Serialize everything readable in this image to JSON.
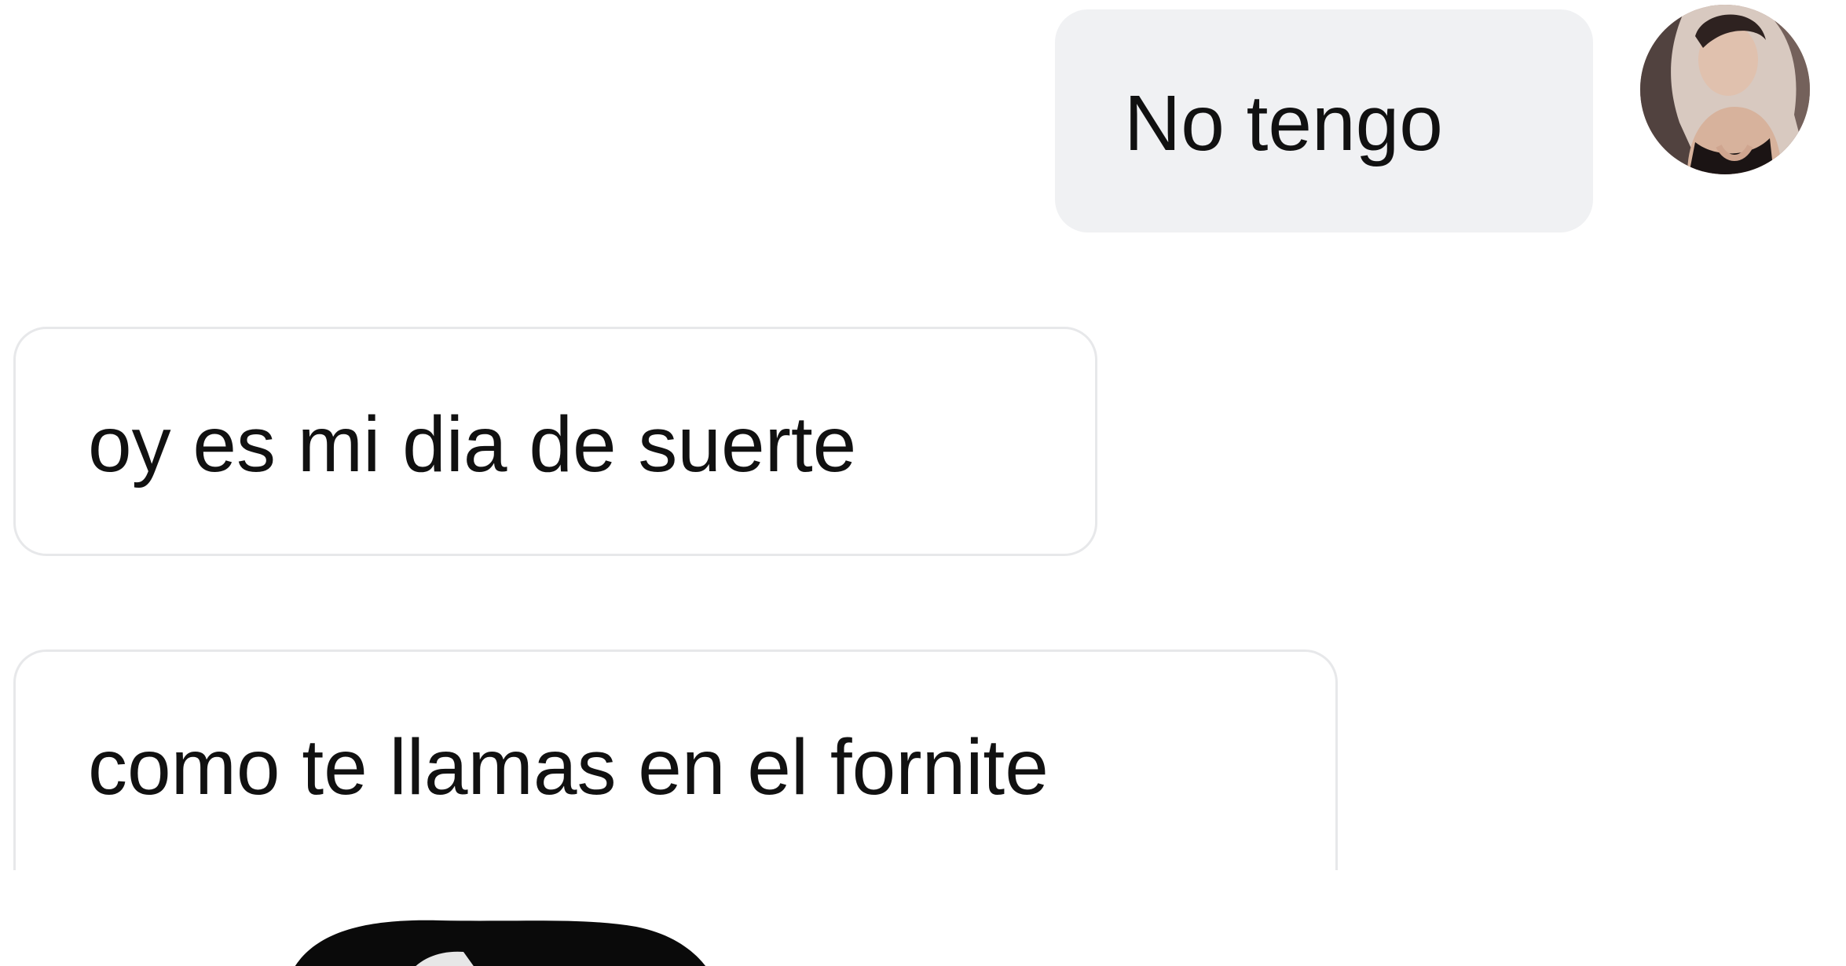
{
  "conversation": {
    "messages": [
      {
        "direction": "outgoing",
        "text": "No tengo"
      },
      {
        "direction": "incoming",
        "text": "oy es mi dia de suerte"
      },
      {
        "direction": "incoming",
        "text": "como te llamas en el fornite"
      }
    ],
    "avatar_icon": "user-photo-avatar"
  },
  "colors": {
    "sent_bubble": "#f0f1f3",
    "received_border": "#e7e8ea",
    "text": "#111111",
    "background": "#ffffff"
  }
}
